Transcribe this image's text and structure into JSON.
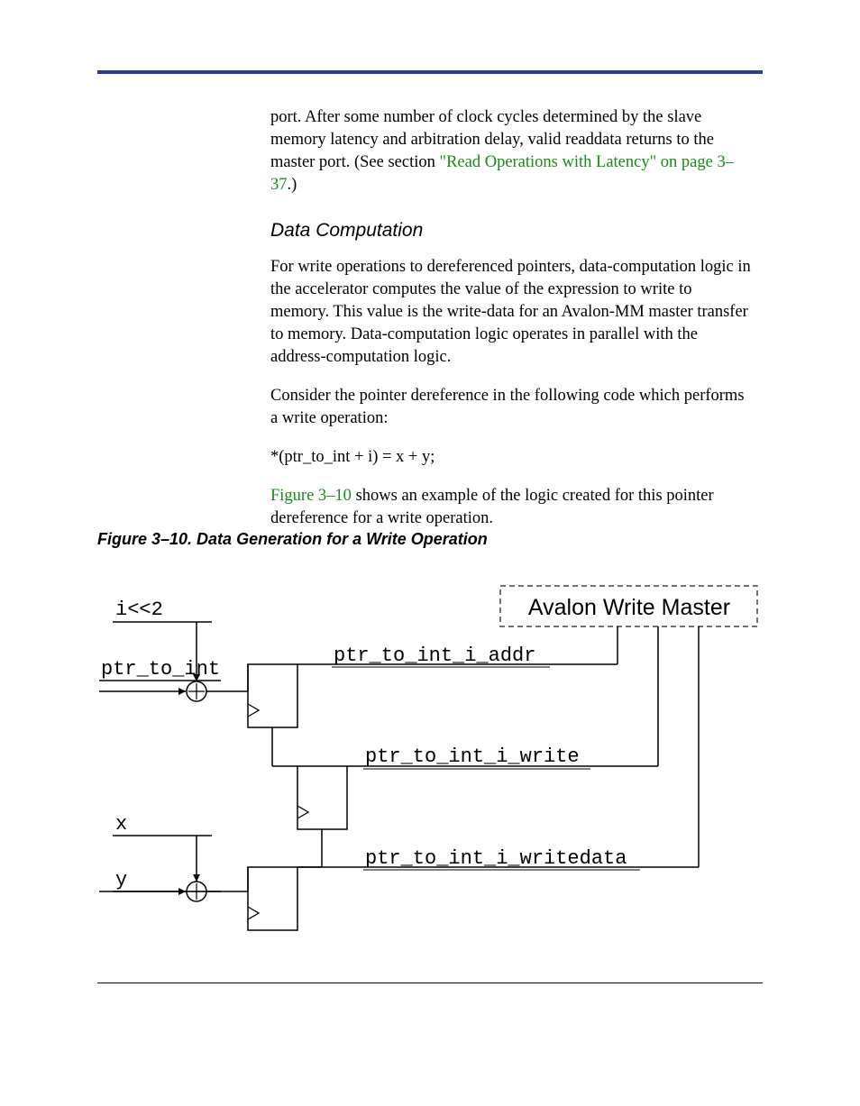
{
  "para1_a": "port. After some number of clock cycles determined by the slave memory latency and arbitration delay, valid ",
  "para1_b": "readdata",
  "para1_c": " returns to the master port. (See section ",
  "para1_link": "\"Read Operations with Latency\" on page 3–37",
  "para1_d": ".)",
  "heading": "Data Computation",
  "para2": "For write operations to dereferenced pointers, data-computation logic in the accelerator computes the value of the expression to write to memory. This value is the write-data for an Avalon-MM master transfer to memory. Data-computation logic operates in parallel with the address-computation logic.",
  "para3": "Consider the pointer dereference in the following code which performs a write operation:",
  "code": "*(ptr_to_int + i) = x + y;",
  "para4_link": "Figure 3–10",
  "para4_b": " shows an example of the logic created for this pointer dereference for a write operation.",
  "caption": "Figure 3–10. Data Generation for a Write Operation",
  "fig": {
    "shift": "i<<2",
    "ptr": "ptr_to_int",
    "addr": "ptr_to_int_i_addr",
    "write": "ptr_to_int_i_write",
    "wdata": "ptr_to_int_i_writedata",
    "x": "x",
    "y": "y",
    "box": "Avalon Write Master"
  }
}
